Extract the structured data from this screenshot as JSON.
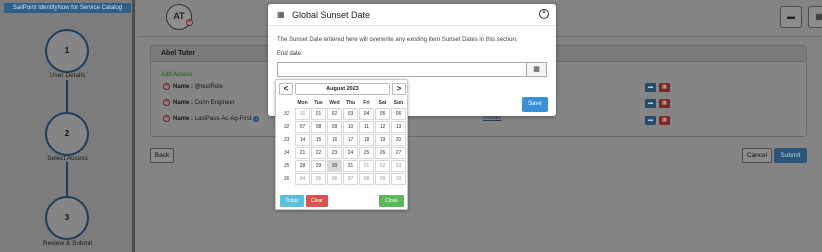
{
  "sidebar": {
    "title": "SailPoint IdentityNow for Service Catalog",
    "steps": [
      {
        "number": "1",
        "label": "User Details"
      },
      {
        "number": "2",
        "label": "Select Access"
      },
      {
        "number": "3",
        "label": "Review & Submit"
      }
    ]
  },
  "header": {
    "avatar_initials": "AT",
    "avatar_badge_icon": "close-icon",
    "buttons": [
      {
        "icon": "message-icon"
      },
      {
        "icon": "calendar-icon"
      }
    ]
  },
  "card": {
    "user_name": "Abel Tuter",
    "section_label": "Add Access",
    "items": [
      {
        "label": "Name :",
        "value": "@testRole"
      },
      {
        "label": "Name :",
        "value": "Conn Engineer"
      },
      {
        "label": "Name :",
        "value": "LastPass-Ac-Ag-First"
      }
    ],
    "details_link": "Details"
  },
  "footer": {
    "back_label": "Back",
    "cancel_label": "Cancel",
    "submit_label": "Submit"
  },
  "modal": {
    "title": "Global Sunset Date",
    "message": "The Sunset Date entered here will overwrite any existing item Sunset Dates in this section.",
    "end_date_label": "End date:",
    "end_date_value": "",
    "save_label": "Save"
  },
  "datepicker": {
    "month_label": "August 2023",
    "prev_label": "<",
    "next_label": ">",
    "weekdays": [
      "Mon",
      "Tue",
      "Wed",
      "Thu",
      "Fri",
      "Sat",
      "Sun"
    ],
    "weeks": [
      {
        "week": "31",
        "days": [
          "31",
          "01",
          "02",
          "03",
          "04",
          "05",
          "06"
        ]
      },
      {
        "week": "32",
        "days": [
          "07",
          "08",
          "09",
          "10",
          "11",
          "12",
          "13"
        ]
      },
      {
        "week": "33",
        "days": [
          "14",
          "15",
          "16",
          "17",
          "18",
          "19",
          "20"
        ]
      },
      {
        "week": "34",
        "days": [
          "21",
          "22",
          "23",
          "24",
          "25",
          "26",
          "27"
        ]
      },
      {
        "week": "35",
        "days": [
          "28",
          "29",
          "30",
          "31",
          "01",
          "02",
          "03"
        ]
      },
      {
        "week": "36",
        "days": [
          "04",
          "05",
          "06",
          "07",
          "08",
          "09",
          "10"
        ]
      }
    ],
    "today_label": "Today",
    "clear_label": "Clear",
    "close_label": "Close",
    "colors": {
      "today": "#5bc0de",
      "clear": "#d9534f",
      "close": "#5cb85c"
    }
  },
  "colors": {
    "sidebar_title_bg": "#2e5f87",
    "primary": "#3a8fd9",
    "danger": "#7d2828"
  }
}
